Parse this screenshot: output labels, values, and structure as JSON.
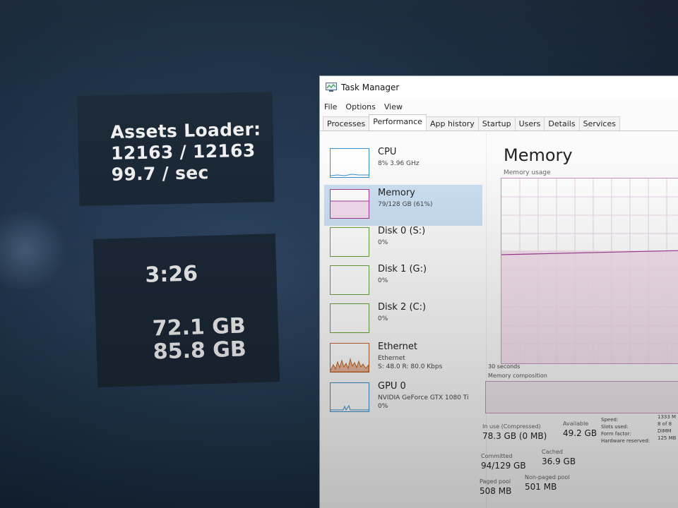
{
  "overlay": {
    "assets_label": "Assets Loader:",
    "assets_count": "12163 / 12163",
    "assets_rate": "99.7 / sec",
    "time": "3:26",
    "gb_1": "72.1 GB",
    "gb_2": "85.8 GB"
  },
  "window": {
    "title": "Task Manager",
    "menu": [
      "File",
      "Options",
      "View"
    ],
    "tabs": [
      "Processes",
      "Performance",
      "App history",
      "Startup",
      "Users",
      "Details",
      "Services"
    ],
    "active_tab": "Performance"
  },
  "resources": [
    {
      "name": "CPU",
      "detail": "8% 3.96 GHz",
      "selected": false,
      "color": "#3a8fc8"
    },
    {
      "name": "Memory",
      "detail": "79/128 GB (61%)",
      "selected": true,
      "color": "#a03a90"
    },
    {
      "name": "Disk 0 (S:)",
      "detail": "0%",
      "selected": false,
      "color": "#66a33a"
    },
    {
      "name": "Disk 1 (G:)",
      "detail": "0%",
      "selected": false,
      "color": "#66a33a"
    },
    {
      "name": "Disk 2 (C:)",
      "detail": "0%",
      "selected": false,
      "color": "#66a33a"
    },
    {
      "name": "Ethernet",
      "detail": "Ethernet",
      "detail2": "S: 48.0 R: 80.0 Kbps",
      "selected": false,
      "color": "#c0652a"
    },
    {
      "name": "GPU 0",
      "detail": "NVIDIA GeForce GTX 1080 Ti",
      "detail2": "0%",
      "selected": false,
      "color": "#3a8fc8"
    }
  ],
  "memory": {
    "title": "Memory",
    "usage_label": "Memory usage",
    "seconds_label": "30 seconds",
    "composition_label": "Memory composition",
    "usage_fraction": 0.61,
    "in_use_label": "In use (Compressed)",
    "in_use_value": "78.3 GB (0 MB)",
    "available_label": "Available",
    "available_value": "49.2 GB",
    "committed_label": "Committed",
    "committed_value": "94/129 GB",
    "cached_label": "Cached",
    "cached_value": "36.9 GB",
    "paged_label": "Paged pool",
    "paged_value": "508 MB",
    "nonpaged_label": "Non-paged pool",
    "nonpaged_value": "501 MB",
    "speed_label": "Speed:",
    "speed_value": "1333 M",
    "slots_label": "Slots used:",
    "slots_value": "8 of 8",
    "form_label": "Form factor:",
    "form_value": "DIMM",
    "hw_label": "Hardware reserved:",
    "hw_value": "125 MB"
  }
}
